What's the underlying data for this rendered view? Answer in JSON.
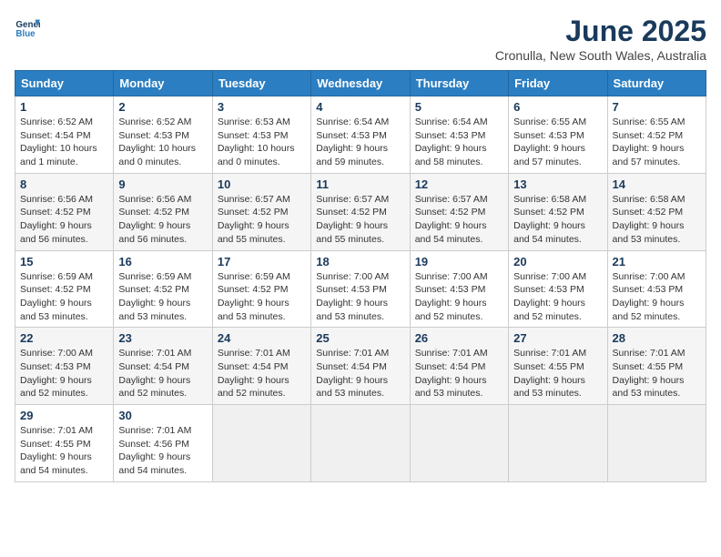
{
  "logo": {
    "line1": "General",
    "line2": "Blue"
  },
  "title": "June 2025",
  "subtitle": "Cronulla, New South Wales, Australia",
  "headers": [
    "Sunday",
    "Monday",
    "Tuesday",
    "Wednesday",
    "Thursday",
    "Friday",
    "Saturday"
  ],
  "weeks": [
    [
      {
        "day": "1",
        "sunrise": "6:52 AM",
        "sunset": "4:54 PM",
        "daylight": "10 hours and 1 minute."
      },
      {
        "day": "2",
        "sunrise": "6:52 AM",
        "sunset": "4:53 PM",
        "daylight": "10 hours and 0 minutes."
      },
      {
        "day": "3",
        "sunrise": "6:53 AM",
        "sunset": "4:53 PM",
        "daylight": "10 hours and 0 minutes."
      },
      {
        "day": "4",
        "sunrise": "6:54 AM",
        "sunset": "4:53 PM",
        "daylight": "9 hours and 59 minutes."
      },
      {
        "day": "5",
        "sunrise": "6:54 AM",
        "sunset": "4:53 PM",
        "daylight": "9 hours and 58 minutes."
      },
      {
        "day": "6",
        "sunrise": "6:55 AM",
        "sunset": "4:53 PM",
        "daylight": "9 hours and 57 minutes."
      },
      {
        "day": "7",
        "sunrise": "6:55 AM",
        "sunset": "4:52 PM",
        "daylight": "9 hours and 57 minutes."
      }
    ],
    [
      {
        "day": "8",
        "sunrise": "6:56 AM",
        "sunset": "4:52 PM",
        "daylight": "9 hours and 56 minutes."
      },
      {
        "day": "9",
        "sunrise": "6:56 AM",
        "sunset": "4:52 PM",
        "daylight": "9 hours and 56 minutes."
      },
      {
        "day": "10",
        "sunrise": "6:57 AM",
        "sunset": "4:52 PM",
        "daylight": "9 hours and 55 minutes."
      },
      {
        "day": "11",
        "sunrise": "6:57 AM",
        "sunset": "4:52 PM",
        "daylight": "9 hours and 55 minutes."
      },
      {
        "day": "12",
        "sunrise": "6:57 AM",
        "sunset": "4:52 PM",
        "daylight": "9 hours and 54 minutes."
      },
      {
        "day": "13",
        "sunrise": "6:58 AM",
        "sunset": "4:52 PM",
        "daylight": "9 hours and 54 minutes."
      },
      {
        "day": "14",
        "sunrise": "6:58 AM",
        "sunset": "4:52 PM",
        "daylight": "9 hours and 53 minutes."
      }
    ],
    [
      {
        "day": "15",
        "sunrise": "6:59 AM",
        "sunset": "4:52 PM",
        "daylight": "9 hours and 53 minutes."
      },
      {
        "day": "16",
        "sunrise": "6:59 AM",
        "sunset": "4:52 PM",
        "daylight": "9 hours and 53 minutes."
      },
      {
        "day": "17",
        "sunrise": "6:59 AM",
        "sunset": "4:52 PM",
        "daylight": "9 hours and 53 minutes."
      },
      {
        "day": "18",
        "sunrise": "7:00 AM",
        "sunset": "4:53 PM",
        "daylight": "9 hours and 53 minutes."
      },
      {
        "day": "19",
        "sunrise": "7:00 AM",
        "sunset": "4:53 PM",
        "daylight": "9 hours and 52 minutes."
      },
      {
        "day": "20",
        "sunrise": "7:00 AM",
        "sunset": "4:53 PM",
        "daylight": "9 hours and 52 minutes."
      },
      {
        "day": "21",
        "sunrise": "7:00 AM",
        "sunset": "4:53 PM",
        "daylight": "9 hours and 52 minutes."
      }
    ],
    [
      {
        "day": "22",
        "sunrise": "7:00 AM",
        "sunset": "4:53 PM",
        "daylight": "9 hours and 52 minutes."
      },
      {
        "day": "23",
        "sunrise": "7:01 AM",
        "sunset": "4:54 PM",
        "daylight": "9 hours and 52 minutes."
      },
      {
        "day": "24",
        "sunrise": "7:01 AM",
        "sunset": "4:54 PM",
        "daylight": "9 hours and 52 minutes."
      },
      {
        "day": "25",
        "sunrise": "7:01 AM",
        "sunset": "4:54 PM",
        "daylight": "9 hours and 53 minutes."
      },
      {
        "day": "26",
        "sunrise": "7:01 AM",
        "sunset": "4:54 PM",
        "daylight": "9 hours and 53 minutes."
      },
      {
        "day": "27",
        "sunrise": "7:01 AM",
        "sunset": "4:55 PM",
        "daylight": "9 hours and 53 minutes."
      },
      {
        "day": "28",
        "sunrise": "7:01 AM",
        "sunset": "4:55 PM",
        "daylight": "9 hours and 53 minutes."
      }
    ],
    [
      {
        "day": "29",
        "sunrise": "7:01 AM",
        "sunset": "4:55 PM",
        "daylight": "9 hours and 54 minutes."
      },
      {
        "day": "30",
        "sunrise": "7:01 AM",
        "sunset": "4:56 PM",
        "daylight": "9 hours and 54 minutes."
      },
      null,
      null,
      null,
      null,
      null
    ]
  ]
}
